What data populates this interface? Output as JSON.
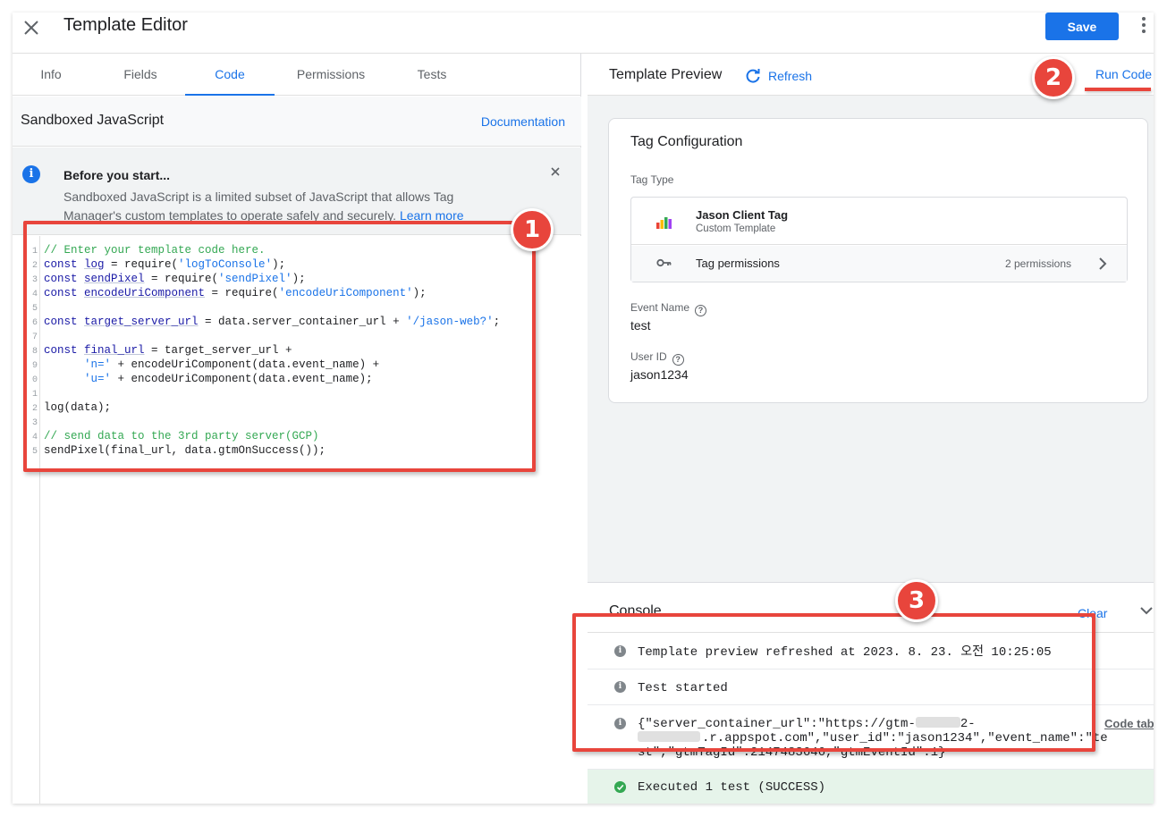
{
  "window": {
    "title": "Template Editor",
    "save_label": "Save"
  },
  "tabs": [
    "Info",
    "Fields",
    "Code",
    "Permissions",
    "Tests"
  ],
  "active_tab": "Code",
  "code_panel": {
    "title": "Sandboxed JavaScript",
    "documentation_link": "Documentation"
  },
  "notice": {
    "title": "Before you start...",
    "text_line1": "Sandboxed JavaScript is a limited subset of JavaScript that allows Tag",
    "text_line2": "Manager's custom templates to operate safely and securely.",
    "learn_more": "Learn more"
  },
  "code": {
    "gutter_numbers": [
      "1",
      "2",
      "3",
      "4",
      "5",
      "6",
      "7",
      "8",
      "9",
      "0",
      "1",
      "2",
      "3",
      "4",
      "5"
    ],
    "lines": [
      "// Enter your template code here.",
      "const log = require('logToConsole');",
      "const sendPixel = require('sendPixel');",
      "const encodeUriComponent = require('encodeUriComponent');",
      "",
      "const target_server_url = data.server_container_url + '/jason-web?';",
      "",
      "const final_url = target_server_url +",
      "      'n=' + encodeUriComponent(data.event_name) +",
      "      'u=' + encodeUriComponent(data.event_name);",
      "",
      "log(data);",
      "",
      "// send data to the 3rd party server(GCP)",
      "sendPixel(final_url, data.gtmOnSuccess());"
    ]
  },
  "preview": {
    "title": "Template Preview",
    "refresh_label": "Refresh",
    "run_code_label": "Run Code"
  },
  "tag_config": {
    "title": "Tag Configuration",
    "tag_type_label": "Tag Type",
    "tag_name": "Jason Client Tag",
    "tag_subtitle": "Custom Template",
    "permissions_label": "Tag permissions",
    "permissions_count": "2 permissions",
    "event_name_label": "Event Name",
    "event_name_value": "test",
    "user_id_label": "User ID",
    "user_id_value": "jason1234"
  },
  "console": {
    "title": "Console",
    "clear_label": "Clear",
    "log1": "Template preview refreshed at 2023. 8. 23. 오전 10:25:05",
    "log2": "Test started",
    "log3_a": "{\"server_container_url\":\"https://gtm-",
    "log3_a_tail": "2-",
    "log3_b_tail": ".r.appspot.com\",\"user_id\":\"jason1234\",\"event_name\":\"te",
    "log3_c": "st\",\"gtmTagId\":2147483646,\"gtmEventId\":1}",
    "code_tab_link": "Code tab",
    "success": "Executed 1 test (SUCCESS)"
  },
  "annotations": {
    "badge1": "1",
    "badge2": "2",
    "badge3": "3"
  },
  "colors": {
    "accent": "#1a73e8",
    "annotation": "#e8453c",
    "success_bg": "#e6f4ea"
  }
}
